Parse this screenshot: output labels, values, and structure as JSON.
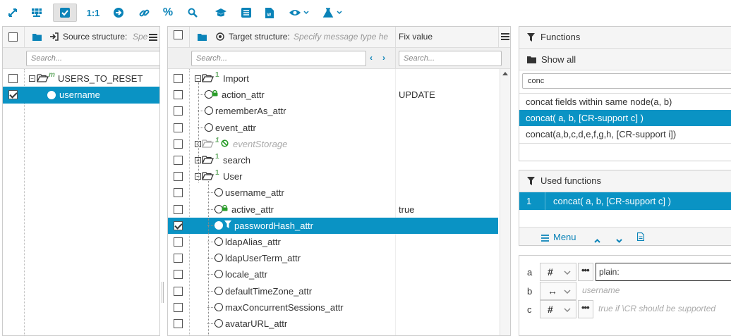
{
  "toolbar": {
    "one_to_one": "1:1",
    "percent": "%"
  },
  "source": {
    "header_label": "Source structure:",
    "header_hint": "Spe",
    "search_placeholder": "Search...",
    "root_name": "USERS_TO_RESET",
    "root_badge": "m",
    "child_name": "username"
  },
  "target": {
    "header_label": "Target structure:",
    "header_hint": "Specify message type he",
    "fix_value_header": "Fix value",
    "search_placeholder": "Search...",
    "fix_search_placeholder": "Search...",
    "rows": [
      {
        "name": "Import",
        "badge": "1",
        "fix": ""
      },
      {
        "name": "action_attr",
        "fix": "UPDATE"
      },
      {
        "name": "rememberAs_attr",
        "fix": ""
      },
      {
        "name": "event_attr",
        "fix": ""
      },
      {
        "name": "eventStorage",
        "badge": "1",
        "fix": ""
      },
      {
        "name": "search",
        "badge": "1",
        "fix": ""
      },
      {
        "name": "User",
        "badge": "1",
        "fix": ""
      },
      {
        "name": "username_attr",
        "fix": ""
      },
      {
        "name": "active_attr",
        "fix": "true"
      },
      {
        "name": "passwordHash_attr",
        "fix": ""
      },
      {
        "name": "ldapAlias_attr",
        "fix": ""
      },
      {
        "name": "ldapUserTerm_attr",
        "fix": ""
      },
      {
        "name": "locale_attr",
        "fix": ""
      },
      {
        "name": "defaultTimeZone_attr",
        "fix": ""
      },
      {
        "name": "maxConcurrentSessions_attr",
        "fix": ""
      },
      {
        "name": "avatarURL_attr",
        "fix": ""
      }
    ]
  },
  "functions": {
    "title": "Functions",
    "show_all": "Show all",
    "filter_value": "conc",
    "items": [
      "concat fields within same node(a, b)",
      "concat( a, b, [CR-support c] )",
      "concat(a,b,c,d,e,f,g,h, [CR-support i])"
    ]
  },
  "used": {
    "title": "Used functions",
    "rows": [
      {
        "index": "1",
        "name": "concat( a, b, [CR-support c] )"
      }
    ],
    "menu_label": "Menu"
  },
  "params": {
    "rows": [
      {
        "label": "a",
        "type": "#",
        "value": "plain:",
        "placeholder": ""
      },
      {
        "label": "b",
        "type": "↔",
        "value": "",
        "placeholder": "username"
      },
      {
        "label": "c",
        "type": "#",
        "value": "",
        "placeholder": "true if \\CR should be supported"
      }
    ]
  },
  "colors": {
    "accent": "#0a93c4",
    "icon": "#0a83b8",
    "badge_green": "#2a9d2a"
  }
}
